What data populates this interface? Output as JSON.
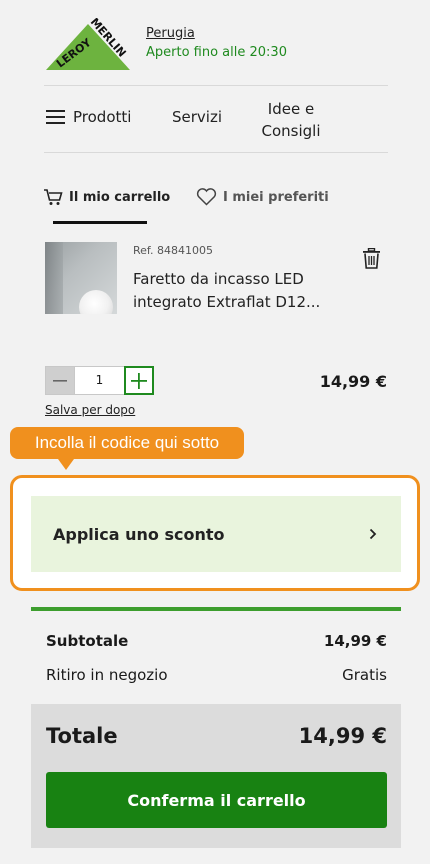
{
  "brand": {
    "logo_text": "LEROY MERLIN"
  },
  "store": {
    "city": "Perugia",
    "hours": "Aperto fino alle 20:30"
  },
  "nav": {
    "products": "Prodotti",
    "services": "Servizi",
    "ideas_line1": "Idee e",
    "ideas_line2": "Consigli"
  },
  "tabs": {
    "cart": "Il mio carrello",
    "favorites": "I miei preferiti",
    "active": "cart"
  },
  "item": {
    "ref": "Ref. 84841005",
    "name_line1": "Faretto da incasso LED",
    "name_line2": "integrato Extraflat D12...",
    "quantity": "1",
    "price": "14,99 €",
    "save_later": "Salva per dopo"
  },
  "tooltip": {
    "text": "Incolla il codice qui sotto"
  },
  "promo": {
    "label": "Applica uno sconto"
  },
  "summary": {
    "subtotal_label": "Subtotale",
    "subtotal_value": "14,99 €",
    "pickup_label": "Ritiro in negozio",
    "pickup_value": "Gratis",
    "total_label": "Totale",
    "total_value": "14,99 €",
    "confirm_label": "Conferma il carrello"
  },
  "colors": {
    "brand_green": "#6db33f",
    "action_green": "#188212",
    "highlight_orange": "#f0901e"
  }
}
